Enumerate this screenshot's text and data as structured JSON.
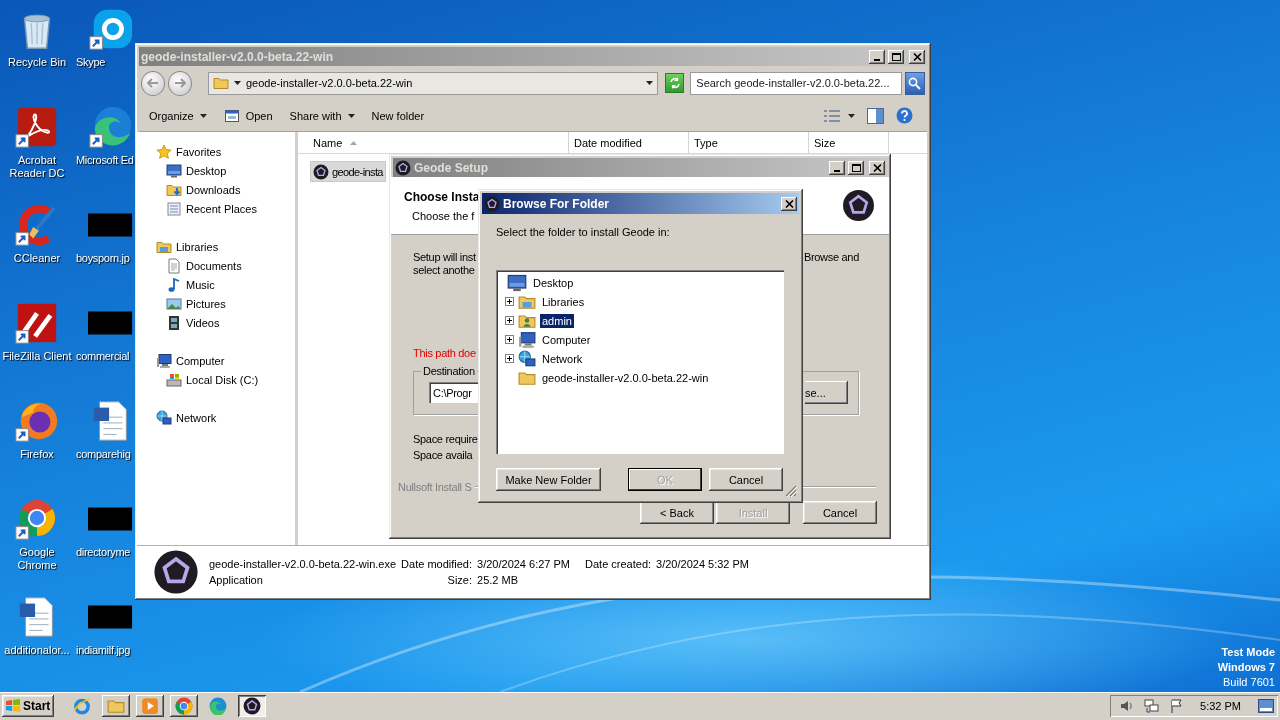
{
  "desktop": {
    "icons": [
      {
        "label": "Recycle Bin",
        "kind": "recycle",
        "shortcut": false
      },
      {
        "label": "Acrobat Reader DC",
        "kind": "acrobat",
        "shortcut": true
      },
      {
        "label": "CCleaner",
        "kind": "ccleaner",
        "shortcut": true
      },
      {
        "label": "FileZilla Client",
        "kind": "filezilla",
        "shortcut": true
      },
      {
        "label": "Firefox",
        "kind": "firefox",
        "shortcut": true
      },
      {
        "label": "Google Chrome",
        "kind": "chrome",
        "shortcut": true
      },
      {
        "label": "additionalor...",
        "kind": "word",
        "shortcut": false
      },
      {
        "label": "Skype",
        "kind": "skype",
        "shortcut": true
      },
      {
        "label": "Microsoft Ed",
        "kind": "edge",
        "shortcut": true
      },
      {
        "label": "boysporn.jp",
        "kind": "thumbnail",
        "shortcut": false
      },
      {
        "label": "commercial",
        "kind": "thumbnail",
        "shortcut": false
      },
      {
        "label": "comparehig",
        "kind": "word",
        "shortcut": false
      },
      {
        "label": "directoryme",
        "kind": "thumbnail",
        "shortcut": false
      },
      {
        "label": "indiamilf.jpg",
        "kind": "thumbnail",
        "shortcut": false
      }
    ],
    "system_text": [
      "Test Mode",
      "Windows 7",
      "Build 7601"
    ]
  },
  "explorer": {
    "title": "geode-installer-v2.0.0-beta.22-win",
    "active": false,
    "address": "geode-installer-v2.0.0-beta.22-win",
    "search": {
      "placeholder": "Search geode-installer-v2.0.0-beta.22..."
    },
    "toolbar": [
      {
        "label": "Organize",
        "kind": "menu"
      },
      {
        "label": "Open",
        "kind": "open"
      },
      {
        "label": "Share with",
        "kind": "menu"
      },
      {
        "label": "New folder",
        "kind": "plain"
      }
    ],
    "navigation": [
      {
        "label": "Favorites",
        "kind": "star",
        "children": [
          {
            "label": "Desktop",
            "kind": "desktop"
          },
          {
            "label": "Downloads",
            "kind": "downloads"
          },
          {
            "label": "Recent Places",
            "kind": "recent"
          }
        ]
      },
      {
        "label": "Libraries",
        "kind": "libraries",
        "children": [
          {
            "label": "Documents",
            "kind": "documents"
          },
          {
            "label": "Music",
            "kind": "music"
          },
          {
            "label": "Pictures",
            "kind": "pictures"
          },
          {
            "label": "Videos",
            "kind": "videos"
          }
        ]
      },
      {
        "label": "Computer",
        "kind": "computer",
        "children": [
          {
            "label": "Local Disk (C:)",
            "kind": "disk"
          }
        ]
      },
      {
        "label": "Network",
        "kind": "network"
      }
    ],
    "columns": [
      {
        "label": "Name",
        "sorted": true
      },
      {
        "label": "Date modified",
        "sorted": false
      },
      {
        "label": "Type",
        "sorted": false
      },
      {
        "label": "Size",
        "sorted": false
      }
    ],
    "files": [
      {
        "name": "geode-insta",
        "selected": true
      }
    ],
    "details": {
      "name": "geode-installer-v2.0.0-beta.22-win.exe",
      "type": "Application",
      "fields": [
        {
          "label": "Date modified:",
          "value": "3/20/2024 6:27 PM"
        },
        {
          "label": "Date created:",
          "value": "3/20/2024 5:32 PM"
        },
        {
          "label": "Size:",
          "value": "25.2 MB"
        }
      ]
    }
  },
  "setup": {
    "title": "Geode Setup",
    "active": false,
    "heading": "Choose Insta",
    "subheading": "Choose the f",
    "intro": [
      "Setup will inst",
      "select anothe"
    ],
    "intro_right": "Browse and",
    "error": "This path doe",
    "destination": {
      "legend": "Destination",
      "value": "C:\\Progr",
      "button": "se..."
    },
    "space": [
      "Space require",
      "Space availa"
    ],
    "branding": "Nullsoft Install S",
    "buttons": [
      {
        "label": "< Back",
        "disabled": false
      },
      {
        "label": "Install",
        "disabled": true
      },
      {
        "label": "Cancel",
        "disabled": false
      }
    ]
  },
  "browse": {
    "title": "Browse For Folder",
    "active": true,
    "prompt": "Select the folder to install Geode in:",
    "tree": [
      {
        "label": "Desktop",
        "kind": "desktop",
        "expandable": false,
        "selected": false,
        "children": [
          {
            "label": "Libraries",
            "kind": "libraries",
            "expandable": true,
            "selected": false
          },
          {
            "label": "admin",
            "kind": "user",
            "expandable": true,
            "selected": true
          },
          {
            "label": "Computer",
            "kind": "computer",
            "expandable": true,
            "selected": false
          },
          {
            "label": "Network",
            "kind": "network",
            "expandable": true,
            "selected": false
          },
          {
            "label": "geode-installer-v2.0.0-beta.22-win",
            "kind": "folder",
            "expandable": false,
            "selected": false
          }
        ]
      }
    ],
    "buttons": [
      {
        "label": "Make New Folder",
        "disabled": false,
        "default": false
      },
      {
        "label": "OK",
        "disabled": true,
        "default": true
      },
      {
        "label": "Cancel",
        "disabled": false,
        "default": false
      }
    ]
  },
  "taskbar": {
    "start": "Start",
    "tasks": [
      {
        "kind": "ie",
        "running": false,
        "active": false
      },
      {
        "kind": "explorer",
        "running": true,
        "active": false
      },
      {
        "kind": "media",
        "running": true,
        "active": false
      },
      {
        "kind": "chrome",
        "running": true,
        "active": false
      },
      {
        "kind": "edge",
        "running": false,
        "active": false
      },
      {
        "kind": "geode",
        "running": true,
        "active": true
      }
    ],
    "tray": [
      {
        "kind": "speaker"
      },
      {
        "kind": "network"
      },
      {
        "kind": "flag"
      }
    ],
    "clock": "5:32 PM"
  }
}
